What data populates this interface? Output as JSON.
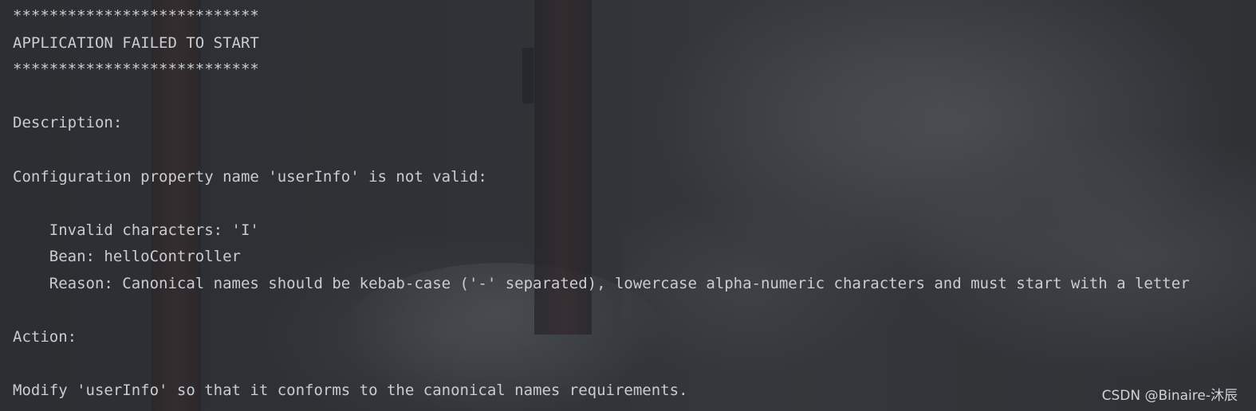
{
  "console": {
    "lines": [
      "***************************",
      "APPLICATION FAILED TO START",
      "***************************",
      "",
      "Description:",
      "",
      "Configuration property name 'userInfo' is not valid:",
      "",
      "    Invalid characters: 'I'",
      "    Bean: helloController",
      "    Reason: Canonical names should be kebab-case ('-' separated), lowercase alpha-numeric characters and must start with a letter",
      "",
      "Action:",
      "",
      "Modify 'userInfo' so that it conforms to the canonical names requirements."
    ]
  },
  "watermark": {
    "text": "CSDN @Binaire-沐辰"
  },
  "colors": {
    "text": "#c9cdd2",
    "background": "#2f3236"
  }
}
